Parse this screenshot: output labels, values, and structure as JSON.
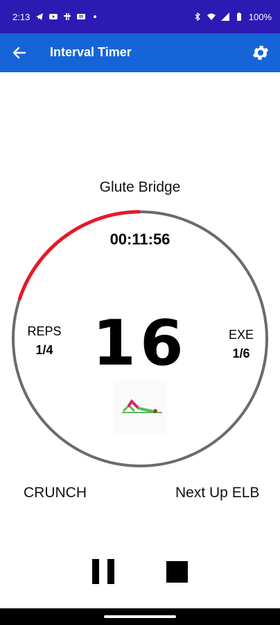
{
  "status": {
    "time": "2:13",
    "battery": "100%"
  },
  "appbar": {
    "title": "Interval Timer"
  },
  "workout": {
    "exercise_name": "Glute Bridge",
    "timer": "00:11:56",
    "countdown": "16",
    "reps_label": "REPS",
    "reps_value": "1/4",
    "exe_label": "EXE",
    "exe_value": "1/6",
    "progress_fraction": 0.2
  },
  "footer": {
    "previous": "CRUNCH",
    "next": "Next Up ELB"
  },
  "colors": {
    "status_bar": "#2d1ab3",
    "app_bar": "#1665d8",
    "progress": "#e8182a",
    "ring": "#6b6b6b"
  },
  "icons": [
    "back-arrow-icon",
    "gear-icon",
    "pause-icon",
    "stop-icon",
    "telegram-icon",
    "youtube-icon",
    "bluetooth-icon",
    "wifi-icon",
    "battery-icon"
  ]
}
